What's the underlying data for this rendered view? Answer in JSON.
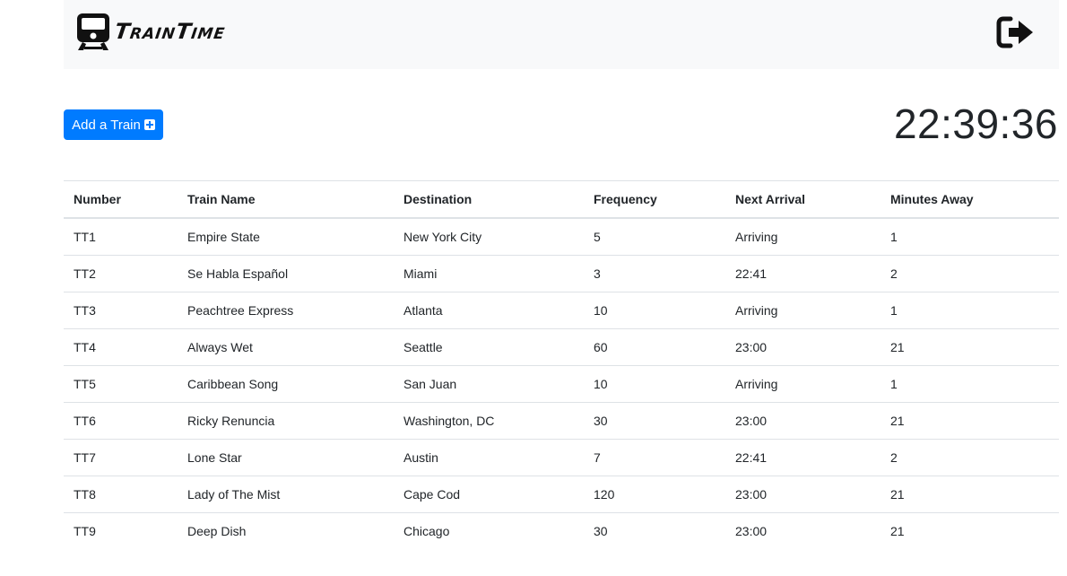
{
  "app": {
    "brand": {
      "part1_cap": "T",
      "part1_rest": "RAIN",
      "part2_cap": "T",
      "part2_rest": "IME"
    }
  },
  "toolbar": {
    "add_label": "Add a Train"
  },
  "clock": {
    "time": "22:39:36"
  },
  "table": {
    "headers": [
      "Number",
      "Train Name",
      "Destination",
      "Frequency",
      "Next Arrival",
      "Minutes Away"
    ],
    "rows": [
      [
        "TT1",
        "Empire State",
        "New York City",
        "5",
        "Arriving",
        "1"
      ],
      [
        "TT2",
        "Se Habla Español",
        "Miami",
        "3",
        "22:41",
        "2"
      ],
      [
        "TT3",
        "Peachtree Express",
        "Atlanta",
        "10",
        "Arriving",
        "1"
      ],
      [
        "TT4",
        "Always Wet",
        "Seattle",
        "60",
        "23:00",
        "21"
      ],
      [
        "TT5",
        "Caribbean Song",
        "San Juan",
        "10",
        "Arriving",
        "1"
      ],
      [
        "TT6",
        "Ricky Renuncia",
        "Washington, DC",
        "30",
        "23:00",
        "21"
      ],
      [
        "TT7",
        "Lone Star",
        "Austin",
        "7",
        "22:41",
        "2"
      ],
      [
        "TT8",
        "Lady of The Mist",
        "Cape Cod",
        "120",
        "23:00",
        "21"
      ],
      [
        "TT9",
        "Deep Dish",
        "Chicago",
        "30",
        "23:00",
        "21"
      ]
    ]
  },
  "icons": {
    "logo": "train-icon",
    "signout": "sign-out-icon",
    "add": "plus-square-icon"
  },
  "colors": {
    "primary": "#007bff",
    "navbar_bg": "#f8f9fa",
    "border": "#dee2e6"
  }
}
